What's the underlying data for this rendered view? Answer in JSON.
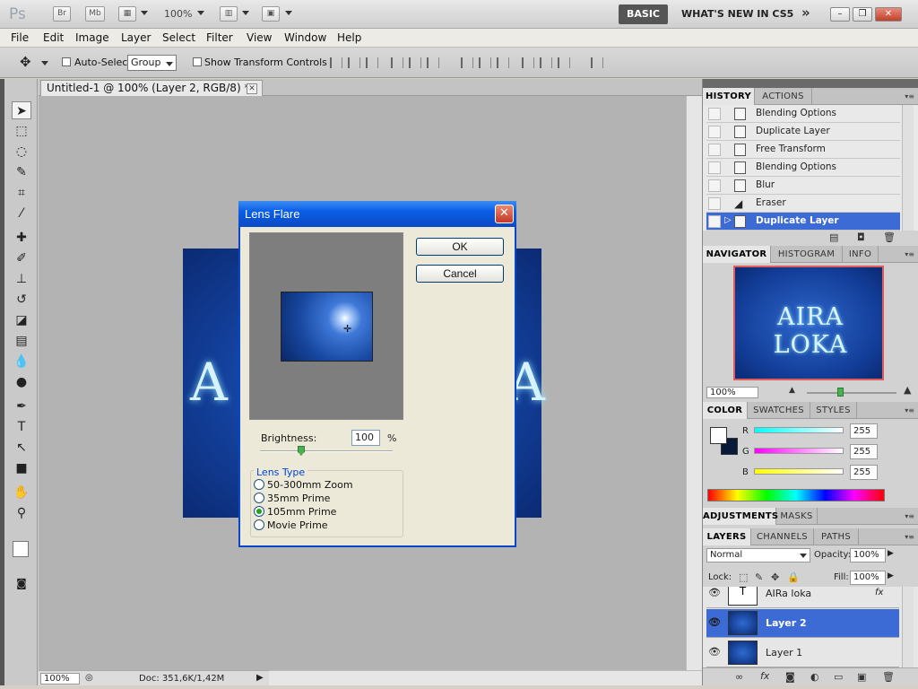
{
  "app": {
    "logo": "Ps",
    "bridge": "Br",
    "minibridge": "Mb",
    "zoom": "100%",
    "workspace": "BASIC",
    "whats_new": "WHAT'S NEW IN CS5",
    "more": "»"
  },
  "menu": [
    "File",
    "Edit",
    "Image",
    "Layer",
    "Select",
    "Filter",
    "View",
    "Window",
    "Help"
  ],
  "options": {
    "auto_select_label": "Auto-Select:",
    "auto_select_value": "Group",
    "transform_label": "Show Transform Controls"
  },
  "document": {
    "tab_title": "Untitled-1 @ 100% (Layer 2, RGB/8) *",
    "text_left": "A",
    "text_right": "A",
    "status_zoom": "100%",
    "doc_size": "Doc: 351,6K/1,42M"
  },
  "dialog": {
    "title": "Lens Flare",
    "ok": "OK",
    "cancel": "Cancel",
    "brightness_label": "Brightness:",
    "brightness_value": "100",
    "brightness_unit": "%",
    "brightness_level": 100,
    "lens_type_label": "Lens Type",
    "lens_types": [
      "50-300mm Zoom",
      "35mm Prime",
      "105mm Prime",
      "Movie Prime"
    ],
    "selected_lens": "105mm Prime"
  },
  "history": {
    "tabs": [
      "HISTORY",
      "ACTIONS"
    ],
    "items": [
      "Blending Options",
      "Duplicate Layer",
      "Free Transform",
      "Blending Options",
      "Blur",
      "Eraser",
      "Duplicate Layer"
    ],
    "selected_index": 6
  },
  "navigator": {
    "tabs": [
      "NAVIGATOR",
      "HISTOGRAM",
      "INFO"
    ],
    "thumb_text": "AIRA LOKA",
    "zoom": "100%"
  },
  "color": {
    "tabs": [
      "COLOR",
      "SWATCHES",
      "STYLES"
    ],
    "labels": [
      "R",
      "G",
      "B"
    ],
    "values": [
      "255",
      "255",
      "255"
    ]
  },
  "adjustments": {
    "tabs": [
      "ADJUSTMENTS",
      "MASKS"
    ]
  },
  "layers": {
    "tabs": [
      "LAYERS",
      "CHANNELS",
      "PATHS"
    ],
    "blend_mode": "Normal",
    "opacity_label": "Opacity:",
    "opacity": "100%",
    "lock_label": "Lock:",
    "fill_label": "Fill:",
    "fill": "100%",
    "items": [
      "AIRa loka",
      "Layer 2",
      "Layer 1"
    ],
    "selected": "Layer 2",
    "text_layer_glyph": "T",
    "fx_glyph": "fx"
  },
  "colors": {
    "accent": "#3c6bd5",
    "dialog_title": "#0a5ee6",
    "canvas_bg": "#b3b3b3"
  }
}
